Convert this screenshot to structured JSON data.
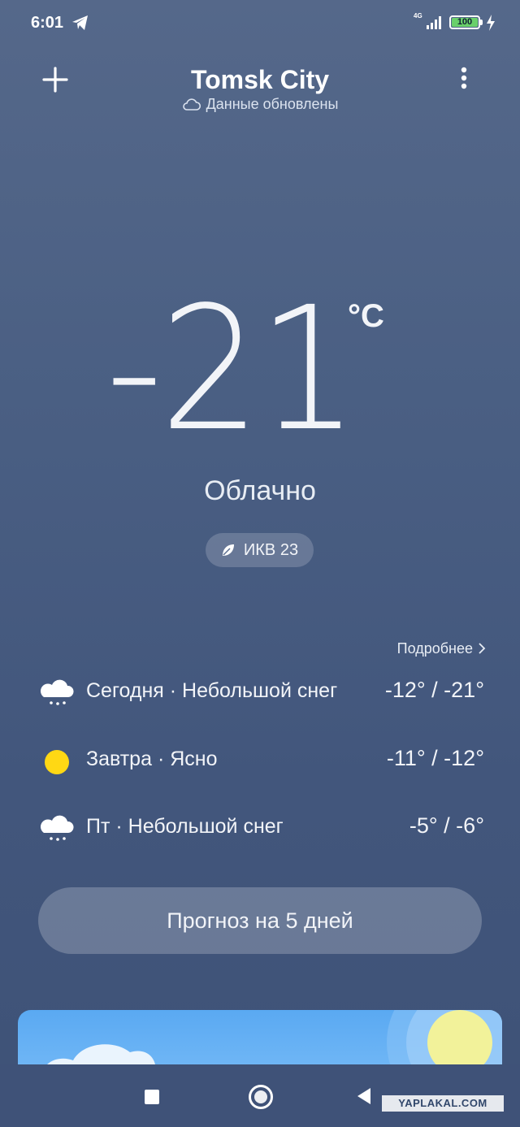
{
  "status_bar": {
    "time": "6:01",
    "network": "4G",
    "battery": "100",
    "icons": [
      "telegram-icon",
      "signal-icon",
      "battery-icon",
      "charging-icon"
    ]
  },
  "header": {
    "city": "Tomsk City",
    "updated": "Данные обновлены",
    "icons": [
      "add-icon",
      "cloud-icon",
      "more-icon"
    ]
  },
  "current": {
    "temperature": "-21",
    "unit": "°C",
    "condition": "Облачно",
    "aqi_label": "ИКВ 23",
    "aqi_icon": "leaf-icon"
  },
  "forecast": {
    "more_label": "Подробнее",
    "days": [
      {
        "label": "Сегодня · Небольшой снег",
        "range": "-12° / -21°",
        "icon": "snow-cloud-icon"
      },
      {
        "label": "Завтра · Ясно",
        "range": "-11° / -12°",
        "icon": "sun-icon"
      },
      {
        "label": "Пт · Небольшой снег",
        "range": "-5° / -6°",
        "icon": "snow-cloud-icon"
      }
    ],
    "button_label": "Прогноз на 5 дней"
  },
  "watermark": "YAPLAKAL.COM",
  "colors": {
    "background_top": "#55688a",
    "background_bottom": "#3e5277",
    "sun": "#ffd814",
    "battery_fill": "#6ad06a",
    "card_sky": "#5aa9f2"
  }
}
